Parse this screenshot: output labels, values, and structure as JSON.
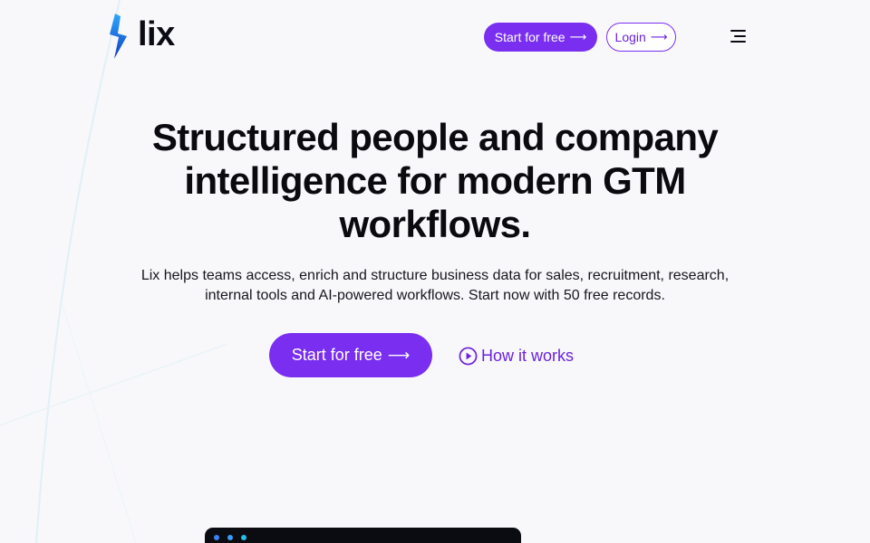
{
  "brand": {
    "name": "lix",
    "colors": {
      "accent": "#7a2ff0",
      "logo_top": "#1e90ff",
      "logo_bottom": "#0f3fbf",
      "dot_1": "#3b82f6",
      "dot_2": "#3b9cf6",
      "dot_3": "#22c1e8"
    }
  },
  "nav": {
    "start_label": "Start for free",
    "login_label": "Login",
    "arrow_icon": "arrow-right-icon",
    "menu_icon": "hamburger-menu-icon"
  },
  "hero": {
    "title": "Structured people and company intelligence for modern GTM workflows.",
    "subtitle": "Lix helps teams access, enrich and structure business data for sales, recruitment, research, internal tools and AI-powered workflows. Start now with 50 free records.",
    "primary_cta": "Start for free",
    "secondary_cta": "How it works",
    "secondary_icon": "play-circle-icon"
  }
}
